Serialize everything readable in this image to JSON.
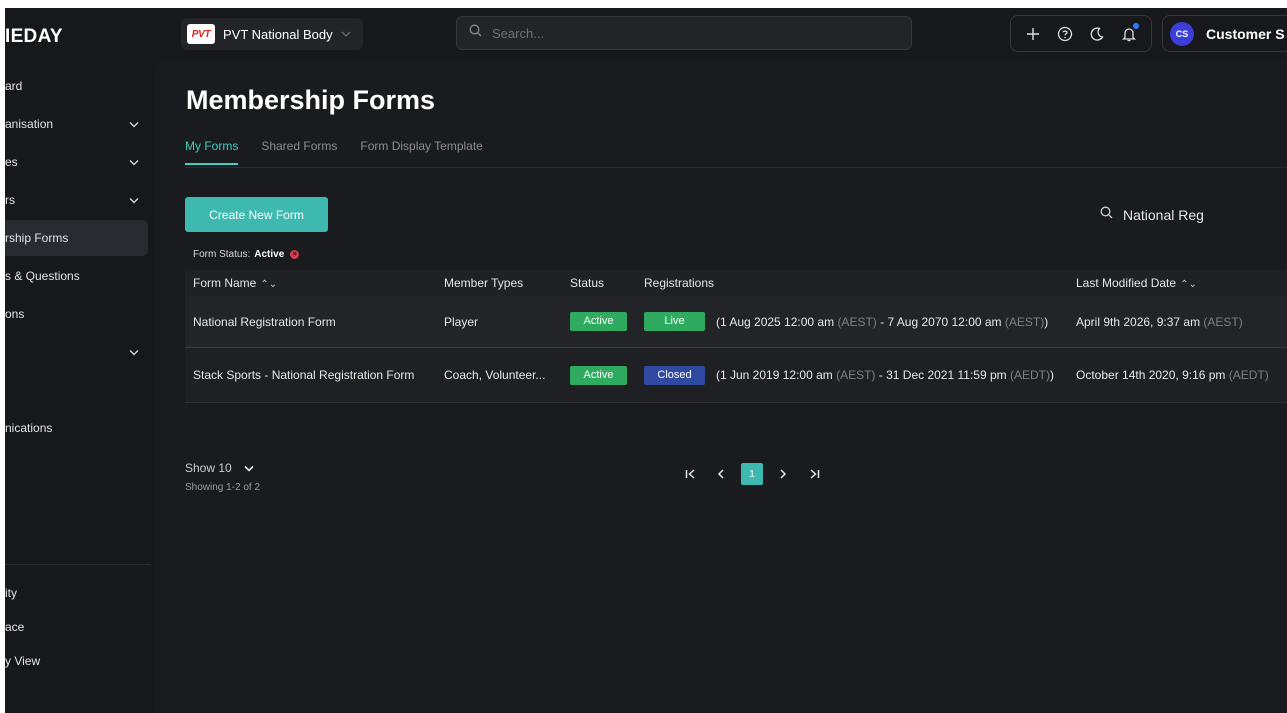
{
  "brand": "IEDAY",
  "org": {
    "logo_text": "PVT",
    "name": "PVT National Body"
  },
  "search": {
    "placeholder": "Search..."
  },
  "user": {
    "initials": "CS",
    "name": "Customer S"
  },
  "icons": {
    "add": "plus-icon",
    "help": "help-circle-icon",
    "theme": "moon-icon",
    "notifications": "bell-icon",
    "search": "search-icon"
  },
  "sidebar": {
    "items": [
      {
        "label": "ard",
        "chevron": false,
        "active": false
      },
      {
        "label": "anisation",
        "chevron": true,
        "active": false
      },
      {
        "label": "es",
        "chevron": true,
        "active": false
      },
      {
        "label": "rs",
        "chevron": true,
        "active": false
      },
      {
        "label": "rship Forms",
        "chevron": false,
        "active": true
      },
      {
        "label": "s & Questions",
        "chevron": false,
        "active": false
      },
      {
        "label": "ons",
        "chevron": false,
        "active": false
      },
      {
        "label": "",
        "chevron": true,
        "active": false
      },
      {
        "label": "nications",
        "chevron": false,
        "active": false
      },
      {
        "label": "ity",
        "chevron": false,
        "active": false
      },
      {
        "label": "ace",
        "chevron": false,
        "active": false
      },
      {
        "label": "y View",
        "chevron": false,
        "active": false
      }
    ]
  },
  "page": {
    "title": "Membership Forms",
    "tabs": [
      {
        "label": "My Forms",
        "active": true
      },
      {
        "label": "Shared Forms",
        "active": false
      },
      {
        "label": "Form Display Template",
        "active": false
      }
    ],
    "create_button": "Create New Form",
    "filter_search_value": "National Reg",
    "status_filter": {
      "label": "Form Status:",
      "value": "Active"
    }
  },
  "table": {
    "headers": {
      "name": "Form Name",
      "member_types": "Member Types",
      "status": "Status",
      "registrations": "Registrations",
      "modified": "Last Modified Date"
    },
    "rows": [
      {
        "name": "National Registration Form",
        "member_types": "Player",
        "status": "Active",
        "reg_badge": "Live",
        "reg_start": "(1 Aug 2025 12:00 am ",
        "reg_start_tz": "(AEST)",
        "reg_sep": " - 7 Aug 2070 12:00 am ",
        "reg_end_tz": "(AEST)",
        "reg_close": ")",
        "modified": "April 9th 2026, 9:37 am ",
        "modified_tz": "(AEST)"
      },
      {
        "name": "Stack Sports - National Registration Form",
        "member_types": "Coach, Volunteer...",
        "status": "Active",
        "reg_badge": "Closed",
        "reg_start": "(1 Jun 2019 12:00 am ",
        "reg_start_tz": "(AEST)",
        "reg_sep": " - 31 Dec 2021 11:59 pm ",
        "reg_end_tz": "(AEDT)",
        "reg_close": ")",
        "modified": "October 14th 2020, 9:16 pm ",
        "modified_tz": "(AEDT)"
      }
    ]
  },
  "pagination": {
    "show_label": "Show 10",
    "showing": "Showing 1-2 of 2",
    "current_page": "1",
    "first": "K",
    "prev": "‹",
    "next": "›",
    "last": "›I"
  },
  "colors": {
    "accent": "#3db9b0",
    "active_badge": "#2fab5f",
    "closed_badge": "#2f4aa0",
    "background": "#17181b"
  }
}
